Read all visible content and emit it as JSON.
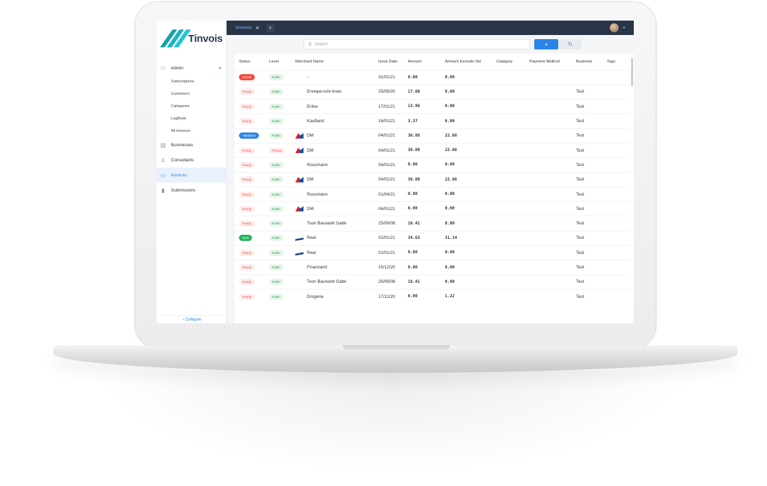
{
  "app": {
    "name": "Tinvois"
  },
  "tabs": [
    {
      "label": "Invoices",
      "close": "✕"
    }
  ],
  "tab_add": "+",
  "sidebar": {
    "admin": {
      "label": "Admin",
      "caret": "▲"
    },
    "sub_items": [
      "Subscriptions",
      "Customers",
      "Categories",
      "LogBook",
      "All Invoices"
    ],
    "items": [
      {
        "label": "Businesses"
      },
      {
        "label": "Consultants"
      },
      {
        "label": "Invoices"
      },
      {
        "label": "Submissions"
      }
    ],
    "collapse": "‹  Collapse"
  },
  "search": {
    "placeholder": "Search",
    "add": "+",
    "refresh": "↻"
  },
  "table": {
    "columns": [
      "Status",
      "Level",
      "Merchant Name",
      "Issue Date",
      "Amount",
      "Amount Exclude Vat",
      "Category",
      "Payment Method",
      "Business",
      "Tags"
    ],
    "rows": [
      {
        "status": "Invalid",
        "level": "Public",
        "logo": "none",
        "merchant": "-",
        "date": "31/01/21",
        "amount": "0.00",
        "excl": "0.00",
        "business": ""
      },
      {
        "status": "Ready",
        "level": "Public",
        "logo": "none",
        "merchant": "Ennepe-ruhr-kreis",
        "date": "25/09/20",
        "amount": "17.60",
        "excl": "0.00",
        "business": "Test"
      },
      {
        "status": "Ready",
        "level": "Public",
        "logo": "none",
        "merchant": "Enbw",
        "date": "17/01/21",
        "amount": "13.96",
        "excl": "0.00",
        "business": "Test"
      },
      {
        "status": "Ready",
        "level": "Public",
        "logo": "none",
        "merchant": "Kaufland",
        "date": "16/01/21",
        "amount": "3.37",
        "excl": "0.00",
        "business": "Test"
      },
      {
        "status": "Validated",
        "level": "Public",
        "logo": "dm",
        "merchant": "DM",
        "date": "04/01/21",
        "amount": "36.80",
        "excl": "22.66",
        "business": "Test"
      },
      {
        "status": "Ready",
        "level": "Private",
        "logo": "dm",
        "merchant": "DM",
        "date": "04/01/21",
        "amount": "36.80",
        "excl": "22.66",
        "business": "Test"
      },
      {
        "status": "Ready",
        "level": "Public",
        "logo": "none",
        "merchant": "Rossmann",
        "date": "04/01/21",
        "amount": "0.00",
        "excl": "0.00",
        "business": "Test"
      },
      {
        "status": "Ready",
        "level": "Public",
        "logo": "dm",
        "merchant": "DM",
        "date": "04/01/21",
        "amount": "36.80",
        "excl": "22.66",
        "business": "Test"
      },
      {
        "status": "Ready",
        "level": "Public",
        "logo": "none",
        "merchant": "Rossmann",
        "date": "01/04/21",
        "amount": "0.00",
        "excl": "0.00",
        "business": "Test"
      },
      {
        "status": "Ready",
        "level": "Public",
        "logo": "dm",
        "merchant": "DM",
        "date": "04/01/21",
        "amount": "0.00",
        "excl": "0.00",
        "business": "Test"
      },
      {
        "status": "Ready",
        "level": "Public",
        "logo": "none",
        "merchant": "Toon Baunarkt Gabk",
        "date": "25/09/08",
        "amount": "16.41",
        "excl": "0.00",
        "business": "Test"
      },
      {
        "status": "Sent",
        "level": "Public",
        "logo": "real",
        "merchant": "Real",
        "date": "02/01/21",
        "amount": "34.63",
        "excl": "31.14",
        "business": "Test"
      },
      {
        "status": "Ready",
        "level": "Public",
        "logo": "real",
        "merchant": "Real",
        "date": "02/01/21",
        "amount": "0.00",
        "excl": "0.00",
        "business": "Test"
      },
      {
        "status": "Ready",
        "level": "Public",
        "logo": "none",
        "merchant": "Finanzamt",
        "date": "15/12/20",
        "amount": "0.00",
        "excl": "0.00",
        "business": "Test"
      },
      {
        "status": "Ready",
        "level": "Public",
        "logo": "none",
        "merchant": "Toon Baunarkt Gabk",
        "date": "25/09/08",
        "amount": "16.41",
        "excl": "0.00",
        "business": "Test"
      },
      {
        "status": "Ready",
        "level": "Public",
        "logo": "none",
        "merchant": "Drogerie",
        "date": "17/12/20",
        "amount": "0.00",
        "excl": "1.22",
        "business": "Test"
      }
    ]
  },
  "colors": {
    "accent": "#2a84e8",
    "topbar": "#2a3447",
    "invalid": "#f5483d",
    "sent": "#23b45d"
  }
}
